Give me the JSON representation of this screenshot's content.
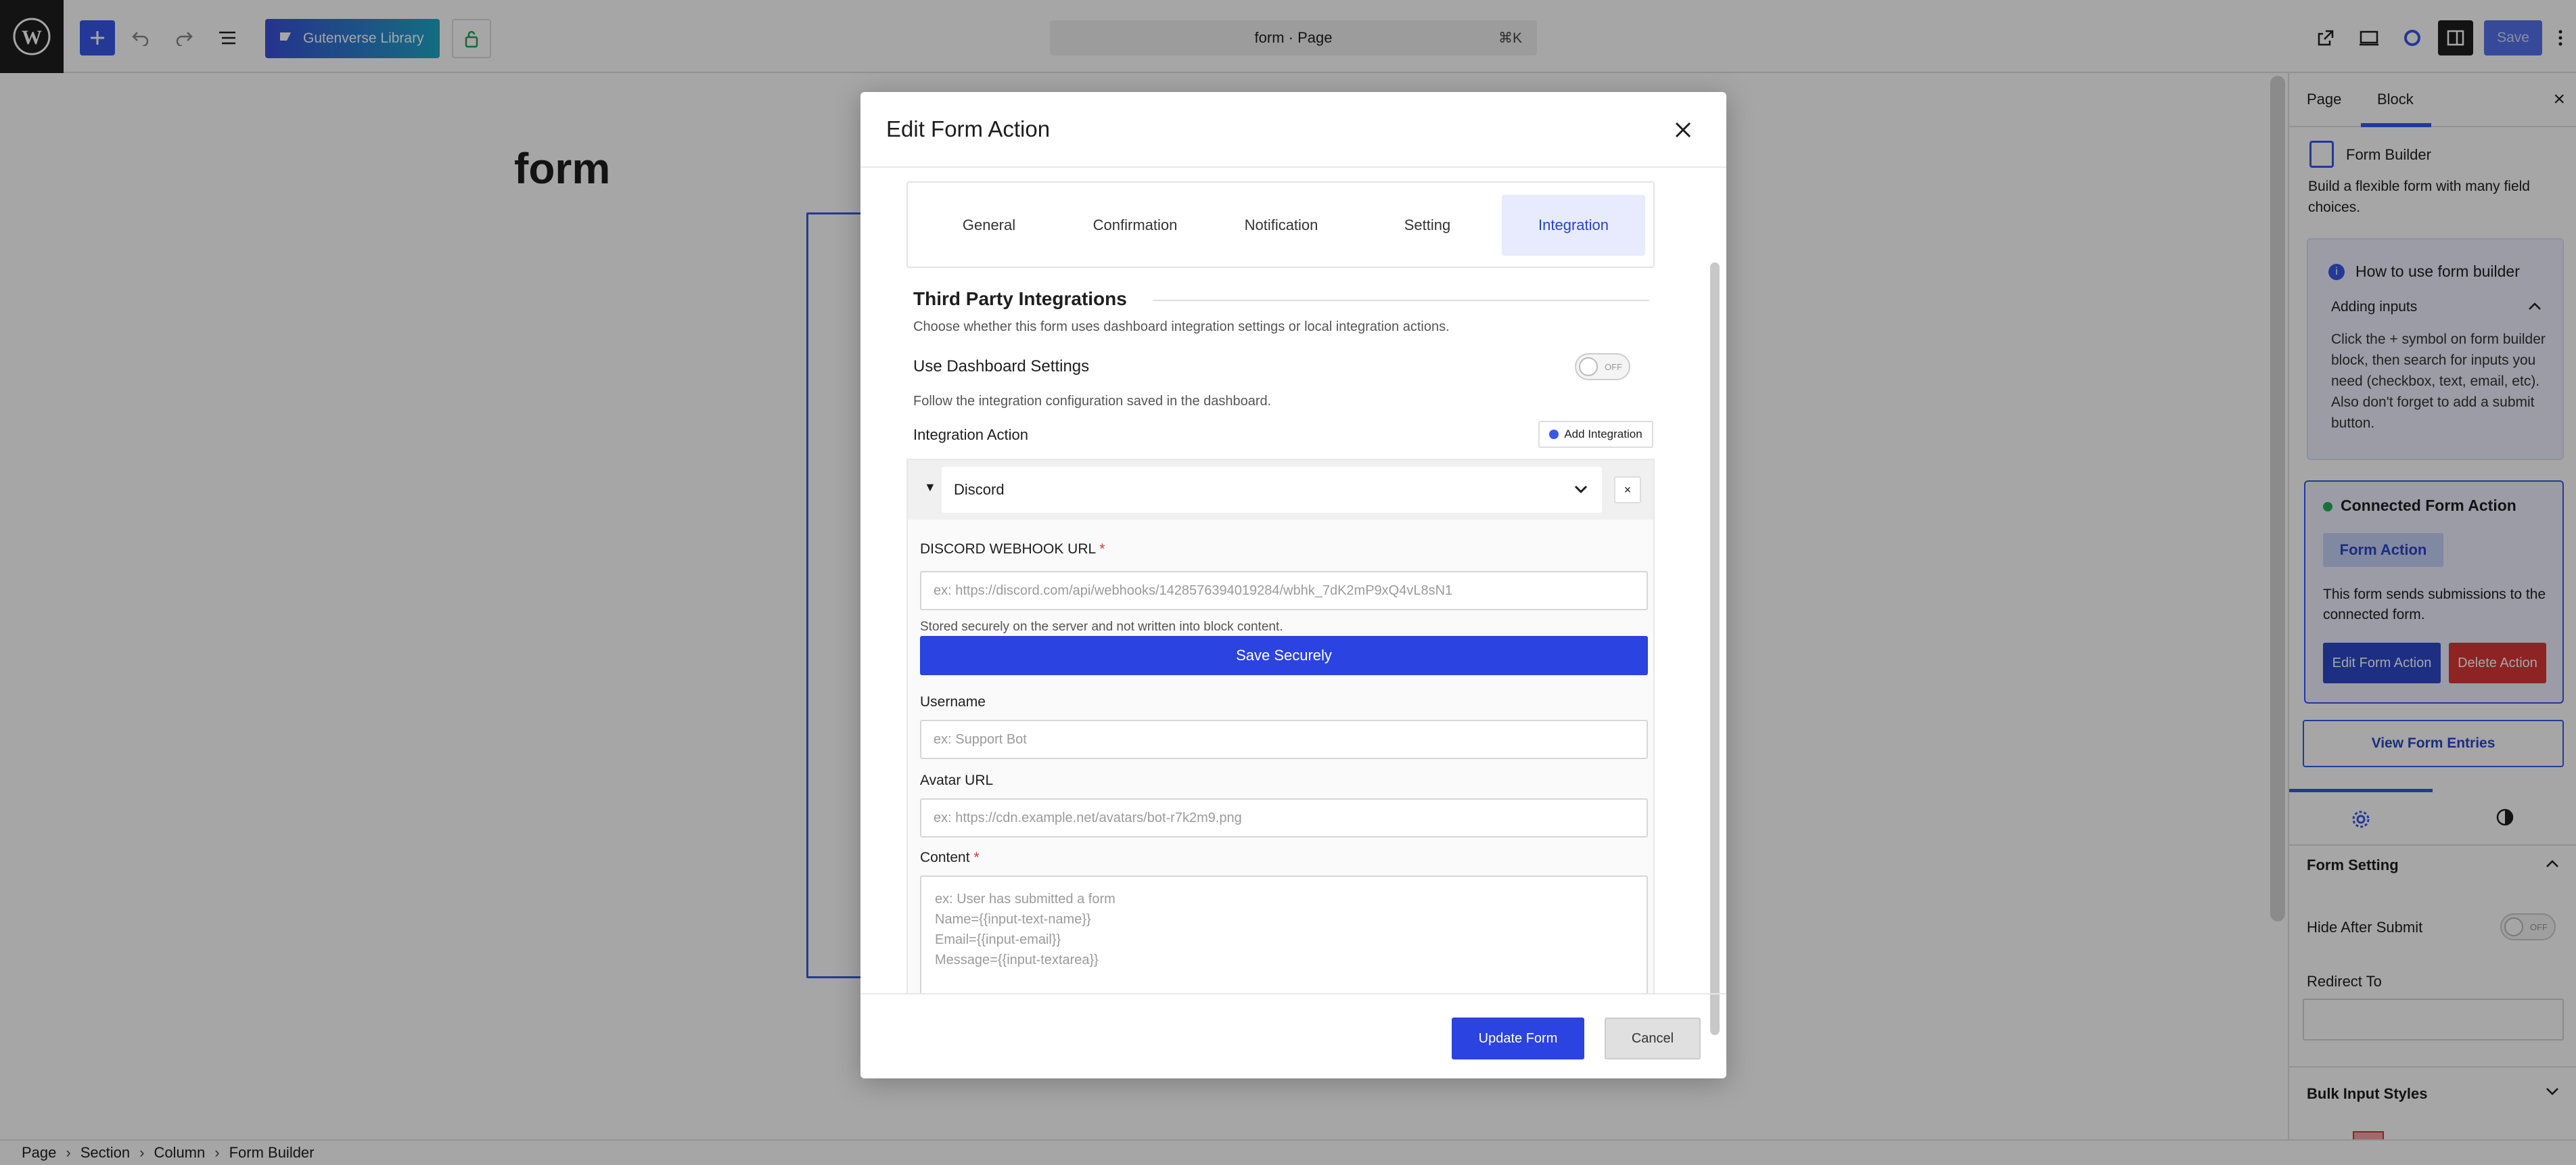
{
  "topbar": {
    "library_label": "Gutenverse Library",
    "command_title": "form · Page",
    "command_shortcut": "⌘K",
    "save_label": "Save"
  },
  "canvas": {
    "page_title": "form"
  },
  "sidebar": {
    "tabs": [
      "Page",
      "Block"
    ],
    "block_name": "Form Builder",
    "block_desc": "Build a flexible form with many field choices.",
    "howto": {
      "title": "How to use form builder",
      "subtitle": "Adding inputs",
      "body": "Click the + symbol on form builder block, then search for inputs you need (checkbox, text, email, etc). Also don't forget to add a submit button."
    },
    "connected": {
      "title": "Connected Form Action",
      "chip": "Form Action",
      "desc": "This form sends submissions to the connected form.",
      "edit_label": "Edit Form Action",
      "delete_label": "Delete Action"
    },
    "view_entries": "View Form Entries",
    "form_setting_title": "Form Setting",
    "hide_after_submit": "Hide After Submit",
    "toggle_off": "OFF",
    "redirect_label": "Redirect To",
    "bulk_title": "Bulk Input Styles"
  },
  "breadcrumb": [
    "Page",
    "Section",
    "Column",
    "Form Builder"
  ],
  "modal": {
    "title": "Edit Form Action",
    "tabs": [
      "General",
      "Confirmation",
      "Notification",
      "Setting",
      "Integration"
    ],
    "active_tab": "Integration",
    "section_title": "Third Party Integrations",
    "section_desc": "Choose whether this form uses dashboard integration settings or local integration actions.",
    "dashboard_label": "Use Dashboard Settings",
    "dashboard_toggle": "OFF",
    "dashboard_desc": "Follow the integration configuration saved in the dashboard.",
    "integration_action_label": "Integration Action",
    "add_integration": "Add Integration",
    "integration_selected": "Discord",
    "webhook_label": "DISCORD WEBHOOK URL",
    "webhook_placeholder": "ex: https://discord.com/api/webhooks/1428576394019284/wbhk_7dK2mP9xQ4vL8sN1",
    "webhook_note": "Stored securely on the server and not written into block content.",
    "save_securely": "Save Securely",
    "username_label": "Username",
    "username_placeholder": "ex: Support Bot",
    "avatar_label": "Avatar URL",
    "avatar_placeholder": "ex: https://cdn.example.net/avatars/bot-r7k2m9.png",
    "content_label": "Content",
    "content_placeholder": "ex: User has submitted a form\nName={{input-text-name}}\nEmail={{input-email}}\nMessage={{input-textarea}}",
    "required_mark": "*",
    "update_label": "Update Form",
    "cancel_label": "Cancel"
  }
}
